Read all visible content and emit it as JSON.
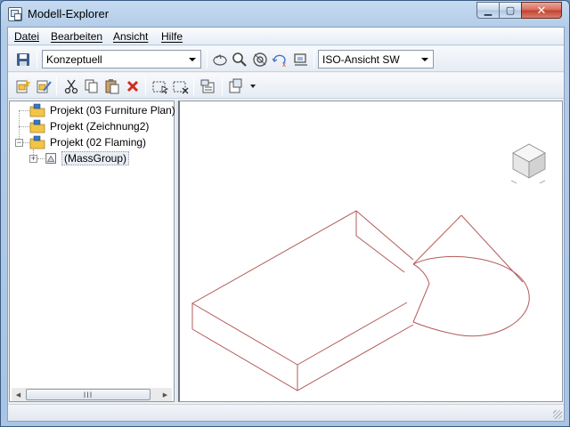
{
  "window": {
    "title": "Modell-Explorer",
    "minimize_glyph": "▁",
    "maximize_glyph": "▢",
    "close_glyph": "✕"
  },
  "menu": {
    "items": [
      "Datei",
      "Bearbeiten",
      "Ansicht",
      "Hilfe"
    ]
  },
  "toolbar1": {
    "save_icon": "save-icon",
    "visual_style": "Konzeptuell",
    "view_buttons": [
      "orbit-icon",
      "zoom-icon",
      "zoom-extents-icon",
      "orbit-x-icon",
      "camera-icon"
    ],
    "view_preset": "ISO-Ansicht SW"
  },
  "toolbar2": {
    "buttons": [
      "new-project-icon",
      "edit-project-icon",
      "cut-icon",
      "copy-icon",
      "paste-icon",
      "delete-icon",
      "select-icon",
      "deselect-icon",
      "properties-icon",
      "new-dropdown-icon"
    ]
  },
  "tree": {
    "items": [
      {
        "label": "Projekt (03 Furniture Plan)"
      },
      {
        "label": "Projekt (Zeichnung2)"
      },
      {
        "label": "Projekt (02 Flaming)",
        "expanded": true
      },
      {
        "label": "(MassGroup)",
        "child": true
      }
    ],
    "scroll_glyph": "III"
  },
  "colors": {
    "model_edges": "#b45a5a",
    "folder_yellow": "#f2c543",
    "accent_blue": "#3d73c4"
  }
}
